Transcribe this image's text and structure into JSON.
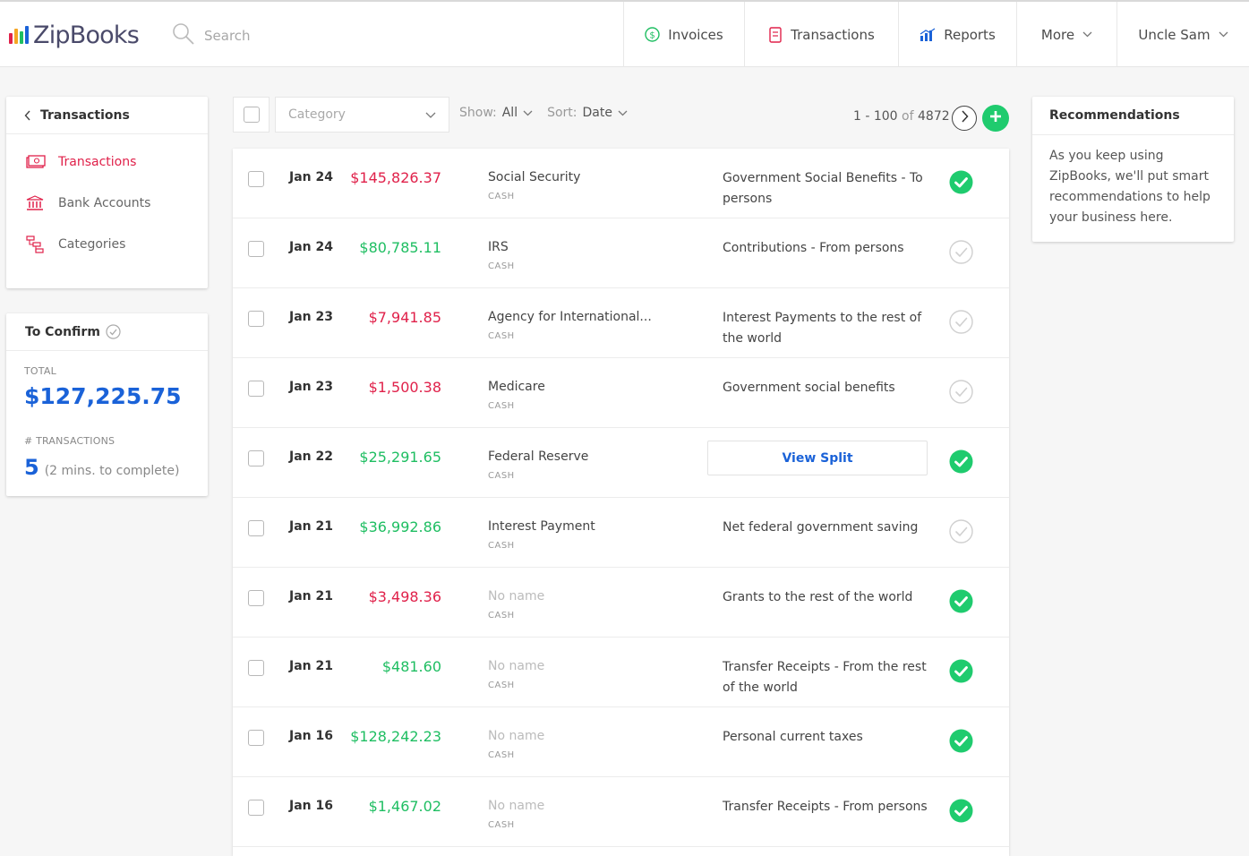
{
  "brand": {
    "name": "ZipBooks",
    "bar_colors": [
      "#e0214a",
      "#f5a623",
      "#1fbe62",
      "#1a62d8"
    ]
  },
  "search": {
    "placeholder": "Search"
  },
  "nav": {
    "invoices": "Invoices",
    "transactions": "Transactions",
    "reports": "Reports",
    "more": "More",
    "user": "Uncle Sam"
  },
  "sidebar": {
    "title": "Transactions",
    "items": [
      {
        "label": "Transactions",
        "icon": "cash-icon",
        "active": true
      },
      {
        "label": "Bank Accounts",
        "icon": "bank-icon",
        "active": false
      },
      {
        "label": "Categories",
        "icon": "categories-icon",
        "active": false
      }
    ]
  },
  "to_confirm": {
    "title": "To Confirm",
    "total_label": "TOTAL",
    "total_value": "$127,225.75",
    "tx_label": "# TRANSACTIONS",
    "tx_count": "5",
    "tx_note": "(2 mins. to complete)"
  },
  "toolbar": {
    "category_placeholder": "Category",
    "show_label": "Show:",
    "show_value": "All",
    "sort_label": "Sort:",
    "sort_value": "Date",
    "range": "1 - 100",
    "of": "of",
    "total": "4872"
  },
  "transactions": [
    {
      "date": "Jan 24",
      "amount": "$145,826.37",
      "sign": "neg",
      "payee": "Social Security",
      "payee_muted": false,
      "account": "CASH",
      "category": "Government Social Benefits - To persons",
      "split": false,
      "confirmed": true
    },
    {
      "date": "Jan 24",
      "amount": "$80,785.11",
      "sign": "pos",
      "payee": "IRS",
      "payee_muted": false,
      "account": "CASH",
      "category": "Contributions - From persons",
      "split": false,
      "confirmed": false
    },
    {
      "date": "Jan 23",
      "amount": "$7,941.85",
      "sign": "neg",
      "payee": "Agency for International...",
      "payee_muted": false,
      "account": "CASH",
      "category": "Interest Payments to the rest of the world",
      "split": false,
      "confirmed": false
    },
    {
      "date": "Jan 23",
      "amount": "$1,500.38",
      "sign": "neg",
      "payee": "Medicare",
      "payee_muted": false,
      "account": "CASH",
      "category": "Government social benefits",
      "split": false,
      "confirmed": false
    },
    {
      "date": "Jan 22",
      "amount": "$25,291.65",
      "sign": "pos",
      "payee": "Federal Reserve",
      "payee_muted": false,
      "account": "CASH",
      "category": "View Split",
      "split": true,
      "confirmed": true
    },
    {
      "date": "Jan 21",
      "amount": "$36,992.86",
      "sign": "pos",
      "payee": "Interest Payment",
      "payee_muted": false,
      "account": "CASH",
      "category": "Net federal government saving",
      "split": false,
      "confirmed": false
    },
    {
      "date": "Jan 21",
      "amount": "$3,498.36",
      "sign": "neg",
      "payee": "No name",
      "payee_muted": true,
      "account": "CASH",
      "category": "Grants to the rest of the world",
      "split": false,
      "confirmed": true
    },
    {
      "date": "Jan 21",
      "amount": "$481.60",
      "sign": "pos",
      "payee": "No name",
      "payee_muted": true,
      "account": "CASH",
      "category": "Transfer Receipts - From the rest of the world",
      "split": false,
      "confirmed": true
    },
    {
      "date": "Jan 16",
      "amount": "$128,242.23",
      "sign": "pos",
      "payee": "No name",
      "payee_muted": true,
      "account": "CASH",
      "category": "Personal current taxes",
      "split": false,
      "confirmed": true
    },
    {
      "date": "Jan 16",
      "amount": "$1,467.02",
      "sign": "pos",
      "payee": "No name",
      "payee_muted": true,
      "account": "CASH",
      "category": "Transfer Receipts - From persons",
      "split": false,
      "confirmed": true
    }
  ],
  "recommendations": {
    "title": "Recommendations",
    "body": "As you keep using ZipBooks, we'll put smart recommendations to help your business here."
  },
  "colors": {
    "accent_red": "#e0214a",
    "accent_green": "#1fcb6e",
    "accent_blue": "#1a62d8"
  }
}
